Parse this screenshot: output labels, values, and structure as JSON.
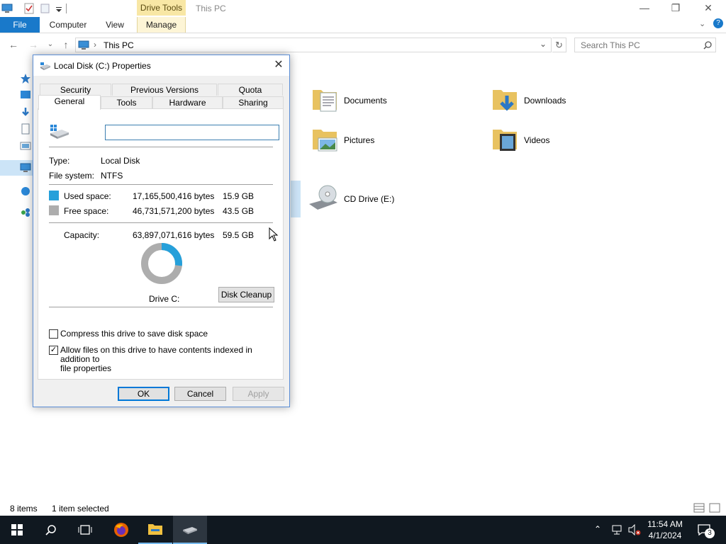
{
  "explorer": {
    "window_title": "This PC",
    "contextual_tab_header": "Drive Tools",
    "ribbon_tabs": [
      "File",
      "Computer",
      "View",
      "Manage"
    ],
    "address": "This PC",
    "search_placeholder": "Search This PC",
    "folders": [
      {
        "label": "Documents",
        "icon": "documents-folder-icon"
      },
      {
        "label": "Downloads",
        "icon": "downloads-folder-icon"
      },
      {
        "label": "Pictures",
        "icon": "pictures-folder-icon"
      },
      {
        "label": "Videos",
        "icon": "videos-folder-icon"
      }
    ],
    "drives": [
      {
        "label": "CD Drive (E:)",
        "icon": "cd-drive-icon"
      }
    ],
    "status": {
      "items": "8 items",
      "selected": "1 item selected"
    }
  },
  "dialog": {
    "title": "Local Disk (C:) Properties",
    "tabs_row1": [
      "Security",
      "Previous Versions",
      "Quota"
    ],
    "tabs_row2": [
      "General",
      "Tools",
      "Hardware",
      "Sharing"
    ],
    "selected_tab": "General",
    "name_value": "",
    "type_label": "Type:",
    "type_value": "Local Disk",
    "fs_label": "File system:",
    "fs_value": "NTFS",
    "used_label": "Used space:",
    "used_bytes": "17,165,500,416 bytes",
    "used_gb": "15.9 GB",
    "free_label": "Free space:",
    "free_bytes": "46,731,571,200 bytes",
    "free_gb": "43.5 GB",
    "capacity_label": "Capacity:",
    "capacity_bytes": "63,897,071,616 bytes",
    "capacity_gb": "59.5 GB",
    "used_fraction": 0.2686,
    "used_color": "#26a0da",
    "free_color": "#adadad",
    "drive_label": "Drive C:",
    "cleanup_button": "Disk Cleanup",
    "compress_label": "Compress this drive to save disk space",
    "compress_checked": false,
    "index_label_line1": "Allow files on this drive to have contents indexed in addition to",
    "index_label_line2": "file properties",
    "index_checked": true,
    "ok": "OK",
    "cancel": "Cancel",
    "apply": "Apply"
  },
  "taskbar": {
    "time": "11:54 AM",
    "date": "4/1/2024",
    "notification_count": "3"
  }
}
